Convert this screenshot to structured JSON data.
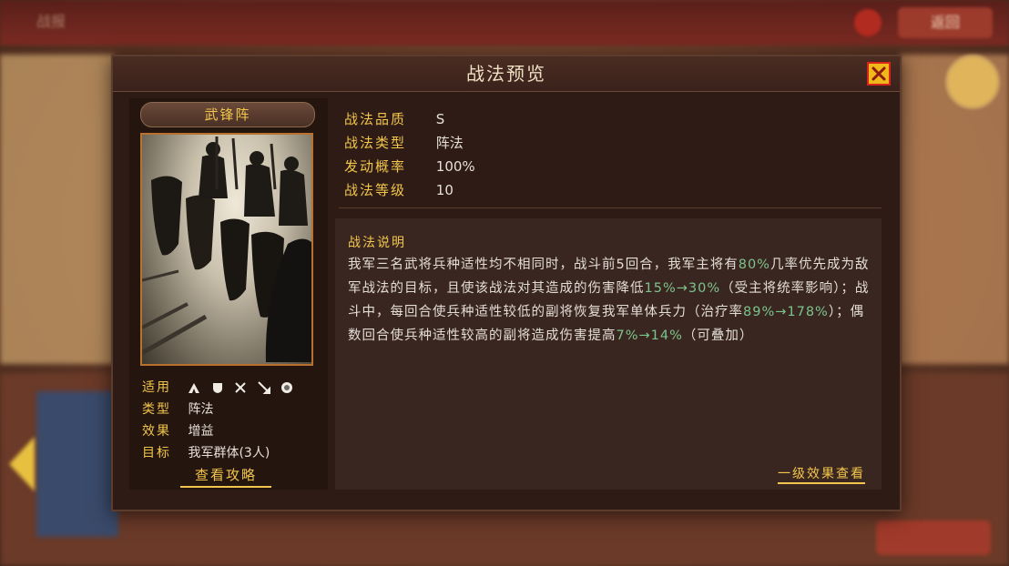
{
  "background": {
    "back_label": "战报",
    "return_label": "返回"
  },
  "dialog": {
    "title": "战法预览"
  },
  "tactic": {
    "name": "武锋阵",
    "attributes": {
      "applicable_label": "适用",
      "troop_icons": [
        "cavalry-icon",
        "shield-icon",
        "archer-icon",
        "spear-icon",
        "siege-icon"
      ],
      "type_label": "类型",
      "type_value": "阵法",
      "effect_label": "效果",
      "effect_value": "增益",
      "target_label": "目标",
      "target_value": "我军群体(3人)"
    },
    "guide_link": "查看攻略"
  },
  "stats": [
    {
      "label": "战法品质",
      "value": "S"
    },
    {
      "label": "战法类型",
      "value": "阵法"
    },
    {
      "label": "发动概率",
      "value": "100%"
    },
    {
      "label": "战法等级",
      "value": "10"
    }
  ],
  "description": {
    "title": "战法说明",
    "p1": "我军三名武将兵种适性均不相同时，战斗前5回合，我军主将有",
    "h1": "80%",
    "p2": "几率优先成为敌军战法的目标，且使该战法对其造成的伤害降低",
    "h2": "15%→30%",
    "p3": "（受主将统率影响）；战斗中，每回合使兵种适性较低的副将恢复我军单体兵力（治疗率",
    "h3": "89%→178%",
    "p4": "）；偶数回合使兵种适性较高的副将造成伤害提高",
    "h4": "7%→14%",
    "p5": "（可叠加）",
    "level_effect_link": "一级效果查看"
  }
}
